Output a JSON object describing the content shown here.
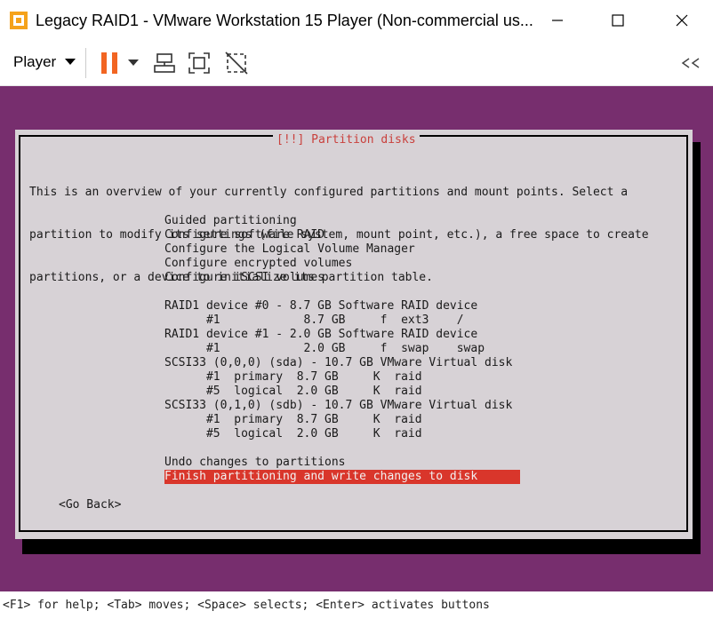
{
  "window": {
    "title": "Legacy RAID1 - VMware Workstation 15 Player (Non-commercial us...",
    "controls": [
      "minimize-icon",
      "maximize-icon",
      "close-icon"
    ]
  },
  "toolbar": {
    "player_menu": "Player",
    "icons": [
      "pause-icon",
      "dropdown-icon",
      "send-ctrl-alt-del-icon",
      "fullscreen-icon",
      "unity-icon",
      "collapse-icon"
    ]
  },
  "dialog": {
    "title": "[!!] Partition disks",
    "intro": [
      "This is an overview of your currently configured partitions and mount points. Select a",
      "partition to modify its settings (file system, mount point, etc.), a free space to create",
      "partitions, or a device to initialize its partition table."
    ],
    "menu_actions": [
      "Guided partitioning",
      "Configure software RAID",
      "Configure the Logical Volume Manager",
      "Configure encrypted volumes",
      "Configure iSCSI volumes"
    ],
    "devices": [
      "RAID1 device #0 - 8.7 GB Software RAID device",
      "      #1            8.7 GB     f  ext3    /",
      "RAID1 device #1 - 2.0 GB Software RAID device",
      "      #1            2.0 GB     f  swap    swap",
      "SCSI33 (0,0,0) (sda) - 10.7 GB VMware Virtual disk",
      "      #1  primary  8.7 GB     K  raid",
      "      #5  logical  2.0 GB     K  raid",
      "SCSI33 (0,1,0) (sdb) - 10.7 GB VMware Virtual disk",
      "      #1  primary  8.7 GB     K  raid",
      "      #5  logical  2.0 GB     K  raid"
    ],
    "undo": "Undo changes to partitions",
    "finish": "Finish partitioning and write changes to disk",
    "go_back": "<Go Back>"
  },
  "status_bar": "<F1> for help; <Tab> moves; <Space> selects; <Enter> activates buttons",
  "colors": {
    "vm_background": "#772e6e",
    "dialog": "#d7d2d6",
    "selection": "#d9362b",
    "title_text": "#c9403c"
  }
}
